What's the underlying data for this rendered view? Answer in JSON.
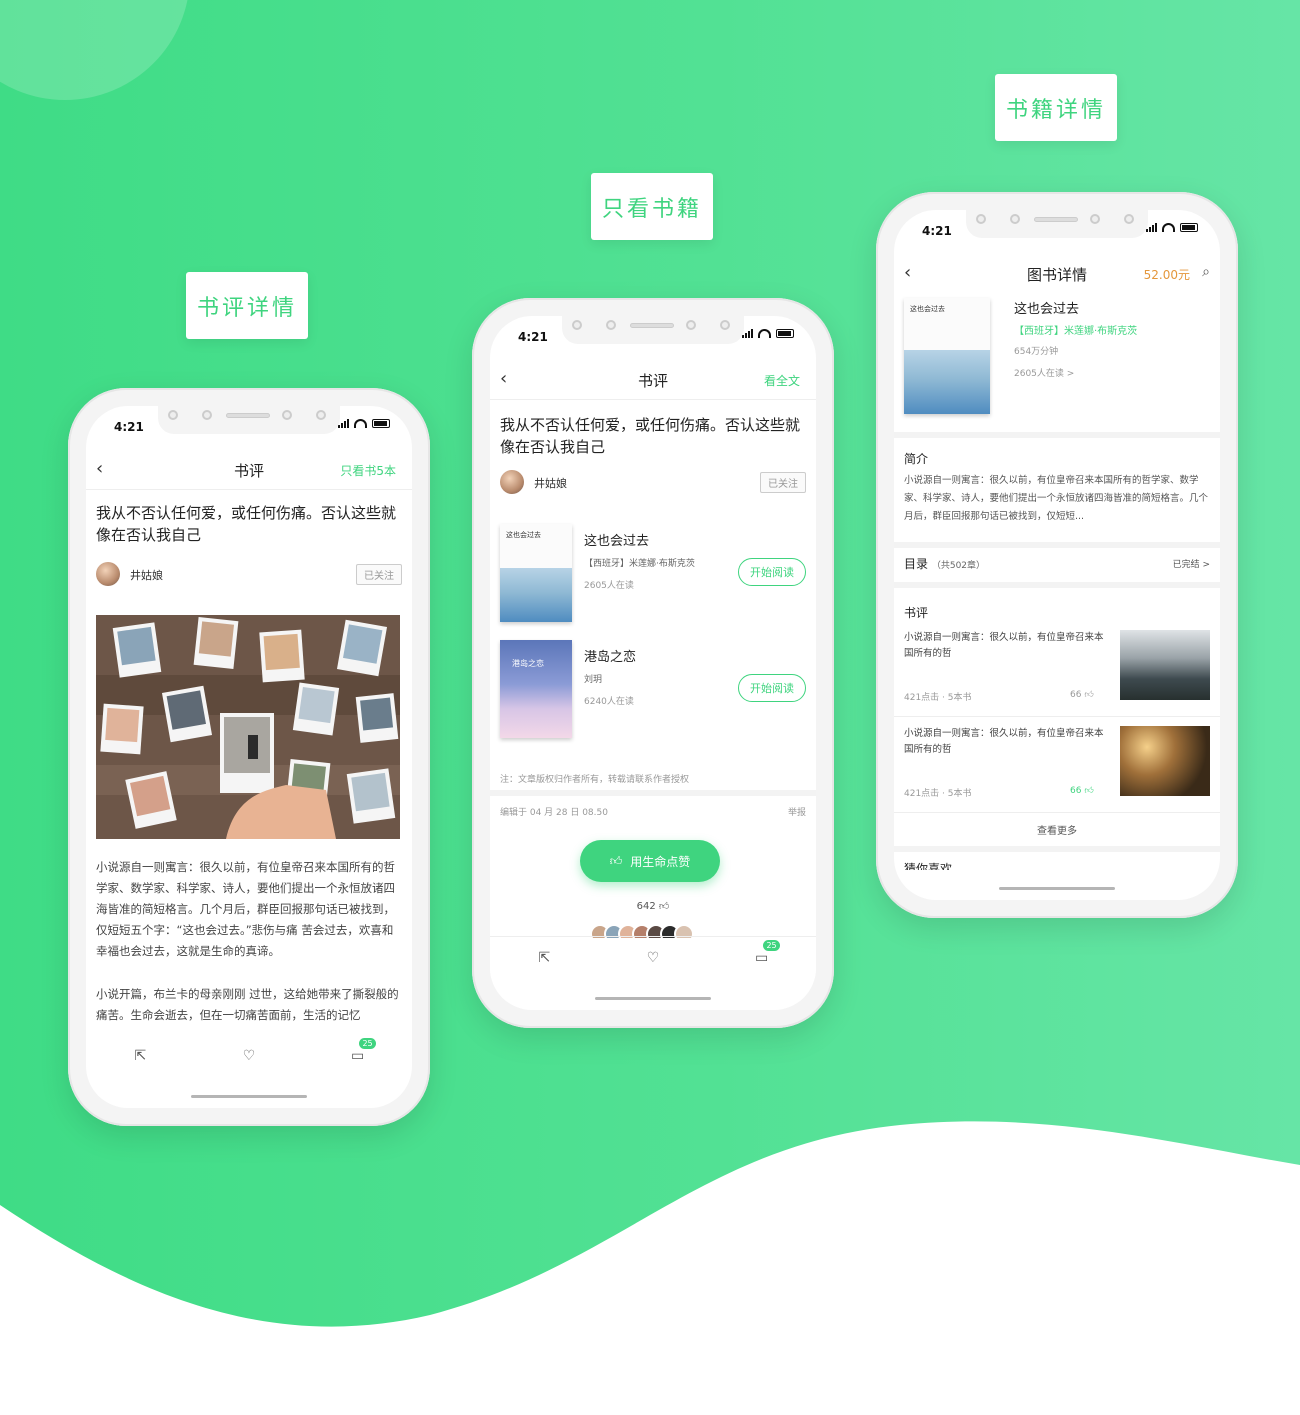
{
  "labels": {
    "left": "书评详情",
    "middle": "只看书籍",
    "right": "书籍详情"
  },
  "status": {
    "time": "4:21"
  },
  "phone1": {
    "nav_title": "书评",
    "nav_right": "只看书5本",
    "article_title": "我从不否认任何爱，或任何伤痛。否认这些就像在否认我自己",
    "author": "井姑娘",
    "follow": "已关注",
    "paragraph1": "小说源自一则寓言：很久以前，有位皇帝召来本国所有的哲学家、数学家、科学家、诗人，要他们提出一个永恒放诸四海皆准的简短格言。几个月后，群臣回报那句话已被找到，仅短短五个字：“这也会过去。”悲伤与痛 苦会过去，欢喜和幸福也会过去，这就是生命的真谛。",
    "paragraph2": "小说开篇，布兰卡的母亲刚刚 过世，这给她带来了撕裂般的痛苦。生命会逝去，但在一切痛苦面前，生活的记忆",
    "comment_badge": "25"
  },
  "phone2": {
    "nav_title": "书评",
    "nav_right": "看全文",
    "article_title": "我从不否认任何爱，或任何伤痛。否认这些就像在否认我自己",
    "author": "井姑娘",
    "follow": "已关注",
    "books": [
      {
        "name": "这也会过去",
        "author": "【西班牙】米莲娜·布斯克茨",
        "readers": "2605人在读",
        "button": "开始阅读",
        "cover_text": "这也会过去"
      },
      {
        "name": "港岛之恋",
        "author": "刘玥",
        "readers": "6240人在读",
        "button": "开始阅读",
        "cover_text": "港岛之恋"
      }
    ],
    "note": "注：文章版权归作者所有，转载请联系作者授权",
    "edit_time": "编辑于 04 月 28 日 08.50",
    "report": "举报",
    "like_button": "用生命点赞",
    "like_count": "642",
    "comment_badge": "25"
  },
  "phone3": {
    "nav_title": "图书详情",
    "price": "52.00元",
    "book_name": "这也会过去",
    "book_author": "【西班牙】米莲娜·布斯克茨",
    "words": "654万分钟",
    "readers": "2605人在读 >",
    "cover_text": "这也会过去",
    "intro_title": "简介",
    "intro_text": "小说源自一则寓言：很久以前，有位皇帝召来本国所有的哲学家、数学家、科学家、诗人，要他们提出一个永恒放诸四海皆准的简短格言。几个月后，群臣回报那句话已被找到，仅短短...",
    "toc_title": "目录",
    "toc_count": "（共502章）",
    "toc_status": "已完结 >",
    "review_title": "书评",
    "reviews": [
      {
        "text": "小说源自一则寓言：很久以前，有位皇帝召来本国所有的哲",
        "meta": "421点击 · 5本书",
        "likes": "66"
      },
      {
        "text": "小说源自一则寓言：很久以前，有位皇帝召来本国所有的哲",
        "meta": "421点击 · 5本书",
        "likes": "66"
      }
    ],
    "more": "查看更多",
    "guess_title": "猜你喜欢"
  }
}
